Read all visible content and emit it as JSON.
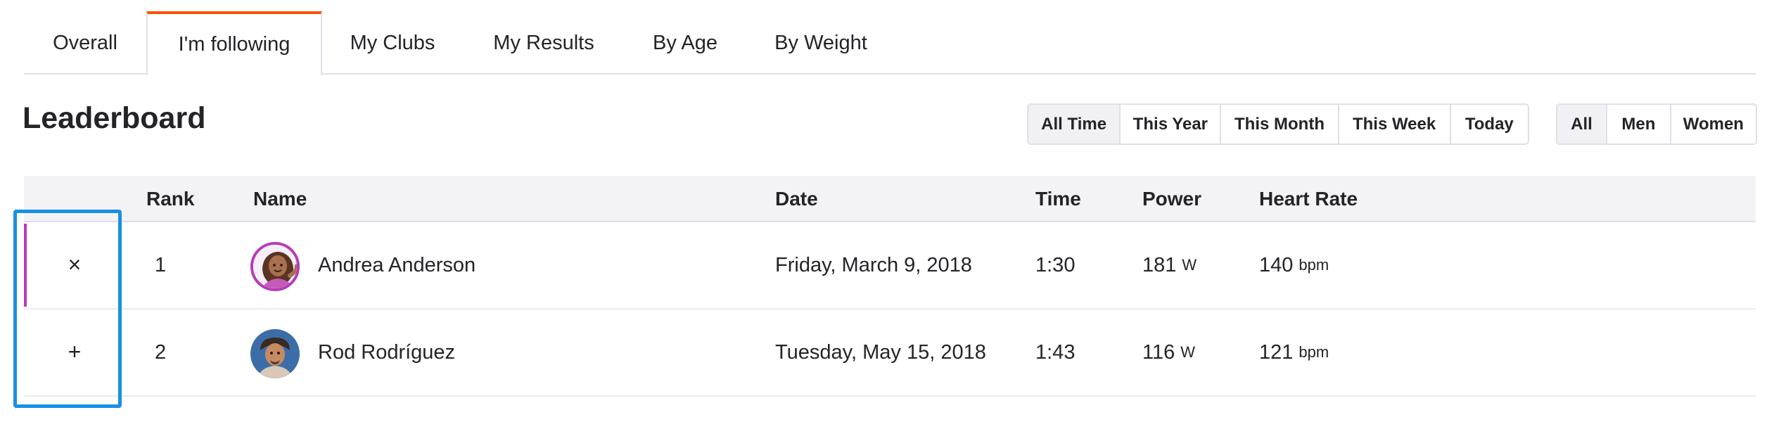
{
  "tabs": [
    {
      "label": "Overall"
    },
    {
      "label": "I'm following"
    },
    {
      "label": "My Clubs"
    },
    {
      "label": "My Results"
    },
    {
      "label": "By Age"
    },
    {
      "label": "By Weight"
    }
  ],
  "active_tab": "I'm following",
  "leaderboard": {
    "title": "Leaderboard",
    "date_filters": [
      "All Time",
      "This Year",
      "This Month",
      "This Week",
      "Today"
    ],
    "date_filter_selected": "All Time",
    "gender_filters": [
      "All",
      "Men",
      "Women"
    ],
    "gender_filter_selected": "All",
    "columns": [
      "Rank",
      "Name",
      "Date",
      "Time",
      "Power",
      "Heart Rate"
    ],
    "rows": [
      {
        "toggle": "×",
        "rank": "1",
        "name": "Andrea Anderson",
        "date": "Friday, March 9, 2018",
        "time": "1:30",
        "power": "181",
        "power_unit": "W",
        "heart_rate": "140",
        "heart_rate_unit": "bpm",
        "followed": true
      },
      {
        "toggle": "+",
        "rank": "2",
        "name": "Rod Rodríguez",
        "date": "Tuesday, May 15, 2018",
        "time": "1:43",
        "power": "116",
        "power_unit": "W",
        "heart_rate": "121",
        "heart_rate_unit": "bpm",
        "followed": false
      }
    ]
  },
  "colors": {
    "accent": "#fc5200",
    "follow_marker": "#b63cba",
    "selection": "#1a8fe3"
  }
}
